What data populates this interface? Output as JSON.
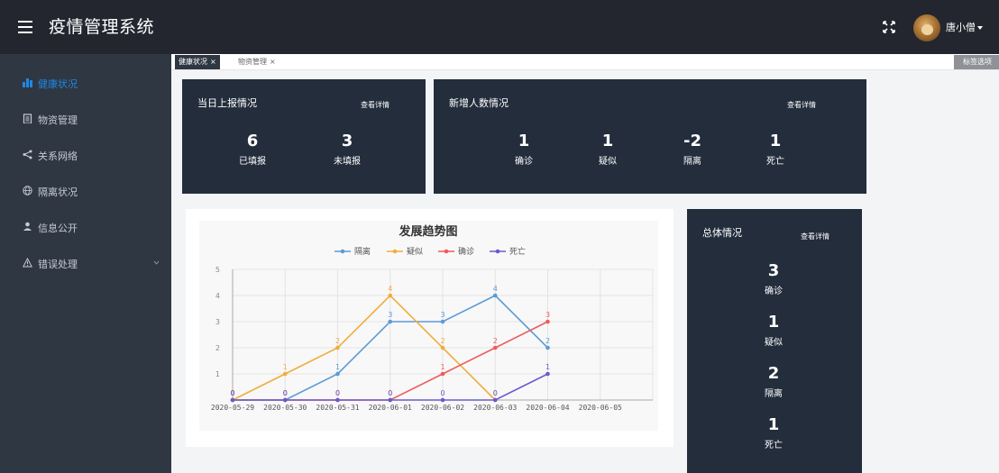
{
  "app": {
    "title": "疫情管理系统"
  },
  "header": {
    "user_name": "唐小僧"
  },
  "sidebar": {
    "items": [
      {
        "label": "健康状况",
        "active": true
      },
      {
        "label": "物资管理"
      },
      {
        "label": "关系网络"
      },
      {
        "label": "隔离状况"
      },
      {
        "label": "信息公开"
      },
      {
        "label": "错误处理"
      }
    ]
  },
  "tabs": [
    {
      "label": "健康状况",
      "active": true
    },
    {
      "label": "物资管理",
      "active": false
    }
  ],
  "tab_options_label": "标签选项",
  "daily_report": {
    "title": "当日上报情况",
    "detail_link": "查看详情",
    "stats": [
      {
        "value": "6",
        "label": "已填报"
      },
      {
        "value": "3",
        "label": "未填报"
      }
    ]
  },
  "new_cases": {
    "title": "新增人数情况",
    "detail_link": "查看详情",
    "stats": [
      {
        "value": "1",
        "label": "确诊"
      },
      {
        "value": "1",
        "label": "疑似"
      },
      {
        "value": "-2",
        "label": "隔离"
      },
      {
        "value": "1",
        "label": "死亡"
      }
    ]
  },
  "overall": {
    "title": "总体情况",
    "detail_link": "查看详情",
    "stats": [
      {
        "value": "3",
        "label": "确诊"
      },
      {
        "value": "1",
        "label": "疑似"
      },
      {
        "value": "2",
        "label": "隔离"
      },
      {
        "value": "1",
        "label": "死亡"
      }
    ]
  },
  "colors": {
    "topbar": "#23262e",
    "sidebar": "#2f3743",
    "card": "#232d3c",
    "accent": "#1e88e5"
  },
  "chart_data": {
    "type": "line",
    "title": "发展趋势图",
    "categories": [
      "2020-05-29",
      "2020-05-30",
      "2020-05-31",
      "2020-06-01",
      "2020-06-02",
      "2020-06-03",
      "2020-06-04",
      "2020-06-05"
    ],
    "ylim": [
      0,
      5
    ],
    "yticks": [
      1,
      2,
      3,
      4,
      5
    ],
    "grid": true,
    "legend": "top",
    "series": [
      {
        "name": "隔离",
        "color": "#5b9bd5",
        "values": [
          0,
          0,
          1,
          3,
          3,
          4,
          2
        ]
      },
      {
        "name": "疑似",
        "color": "#f0ad3c",
        "values": [
          0,
          1,
          2,
          4,
          2,
          0
        ]
      },
      {
        "name": "确诊",
        "color": "#ef5b5b",
        "values": [
          0,
          0,
          0,
          0,
          1,
          2,
          3
        ]
      },
      {
        "name": "死亡",
        "color": "#6a5acd",
        "values": [
          0,
          0,
          0,
          0,
          0,
          0,
          1
        ]
      }
    ]
  }
}
